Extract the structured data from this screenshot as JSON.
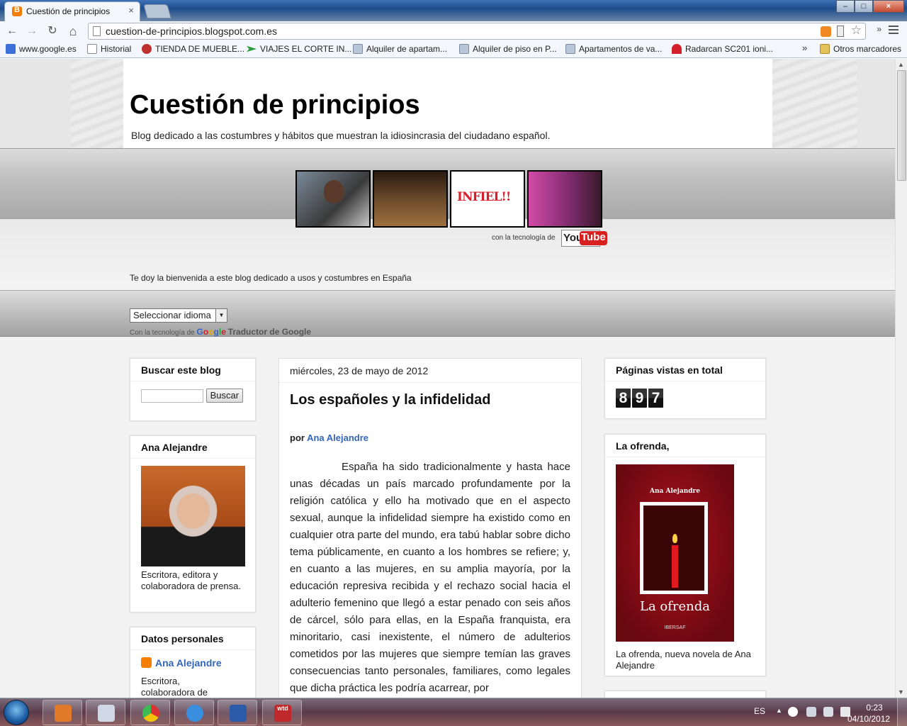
{
  "browser": {
    "tab_title": "Cuestión de principios",
    "tab_close": "×",
    "url": "cuestion-de-principios.blogspot.com.es",
    "more_label": "»",
    "win_min": "–",
    "win_max": "□",
    "win_close": "×",
    "nav": {
      "back": "←",
      "forward": "→",
      "reload": "↻",
      "home": "⌂",
      "star": "☆"
    }
  },
  "bookmarks": {
    "items": [
      {
        "label": "www.google.es",
        "icon": "google-icon"
      },
      {
        "label": "Historial",
        "icon": "page-icon"
      },
      {
        "label": "TIENDA DE MUEBLE...",
        "icon": "knot-icon"
      },
      {
        "label": "VIAJES EL CORTE IN...",
        "icon": "plane-icon"
      },
      {
        "label": "Alquiler de apartam...",
        "icon": "house-icon"
      },
      {
        "label": "Alquiler de piso en P...",
        "icon": "house-icon"
      },
      {
        "label": "Apartamentos de va...",
        "icon": "house-icon"
      },
      {
        "label": "Radarcan SC201 ioni...",
        "icon": "radar-icon"
      }
    ],
    "overflow": "»",
    "other": "Otros marcadores"
  },
  "blog": {
    "title": "Cuestión de principios",
    "description": "Blog dedicado a las costumbres y hábitos que muestran la idiosincrasia del ciudadano español.",
    "video_thumb3": "INFIEL!!",
    "yt_credit": "con la tecnología de",
    "yt_you": "You",
    "yt_tube": "Tube",
    "welcome": "Te doy la bienvenida a este blog dedicado a usos y costumbres en España",
    "lang_select": "Seleccionar idioma",
    "gt_prefix": "Con la tecnología de",
    "gt_g1": "G",
    "gt_g2": "o",
    "gt_g3": "o",
    "gt_g4": "g",
    "gt_g5": "l",
    "gt_g6": "e",
    "gt_suffix": "Traductor de Google"
  },
  "sidebar_left": {
    "search": {
      "title": "Buscar este blog",
      "button": "Buscar"
    },
    "author": {
      "title": "Ana Alejandre",
      "bio": "Escritora, editora y colaboradora de prensa."
    },
    "profile": {
      "title": "Datos personales",
      "name": "Ana Alejandre",
      "bio": "Escritora, colaboradora de"
    }
  },
  "post": {
    "date": "miércoles, 23 de mayo de 2012",
    "title": "Los españoles y la infidelidad",
    "by": "por",
    "author": "Ana Alejandre",
    "text": "España ha sido tradicionalmente y hasta hace unas décadas un país marcado profundamente por la religión católica y ello ha motivado que en el aspecto sexual, aunque la infidelidad siempre ha existido como en cualquier otra parte del mundo, era tabú hablar sobre dicho tema públicamente, en cuanto a los hombres se refiere; y, en cuanto a las mujeres, en su amplia mayoría, por la educación represiva recibida y el rechazo social hacia el adulterio femenino que llegó a estar penado con seis años de cárcel, sólo para ellas, en la España franquista, era minoritario, casi inexistente, el número de adulterios cometidos por las mujeres que siempre temían las graves consecuencias tanto personales, familiares, como legales que dicha práctica les podría acarrear, por"
  },
  "sidebar_right": {
    "views": {
      "title": "Páginas vistas en total",
      "digits": [
        "8",
        "9",
        "7"
      ]
    },
    "book": {
      "title": "La ofrenda,",
      "cover_author": "Ana Alejandre",
      "cover_title": "La ofrenda",
      "cover_publisher": "IBERSAF",
      "caption": "La ofrenda, nueva novela de Ana Alejandre"
    }
  },
  "taskbar": {
    "lang": "ES",
    "tray_up": "▲",
    "time": "0:23",
    "date": "04/10/2012",
    "wtd": "wtd"
  }
}
